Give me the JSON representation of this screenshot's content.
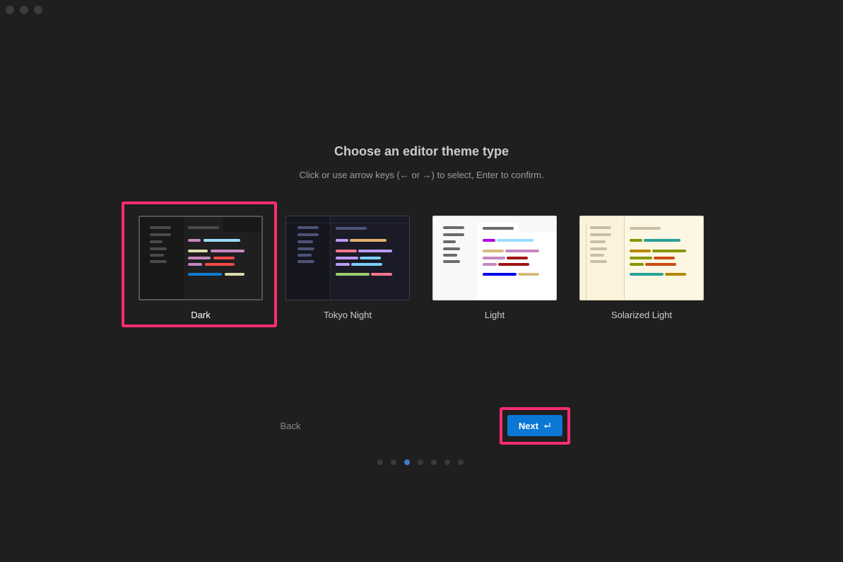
{
  "onboarding": {
    "title": "Choose an editor theme type",
    "subtitle": "Click or use arrow keys (← or →) to select, Enter to confirm.",
    "themes": [
      {
        "label": "Dark",
        "selected": true
      },
      {
        "label": "Tokyo Night",
        "selected": false
      },
      {
        "label": "Light",
        "selected": false
      },
      {
        "label": "Solarized Light",
        "selected": false
      }
    ],
    "back_label": "Back",
    "next_label": "Next",
    "steps": {
      "total": 7,
      "current": 3
    }
  },
  "colors": {
    "accent": "#0a78d4",
    "highlight": "#ff2d72"
  }
}
